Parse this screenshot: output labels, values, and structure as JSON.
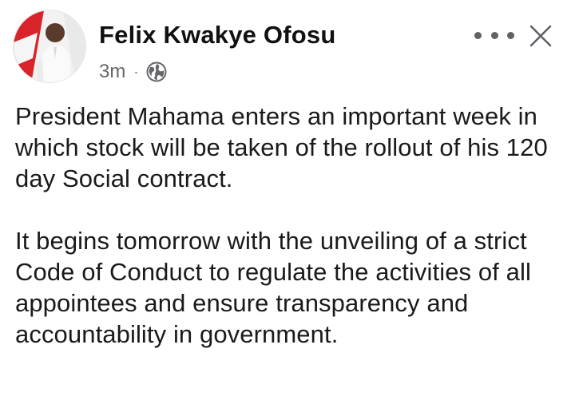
{
  "post": {
    "author": "Felix Kwakye Ofosu",
    "time": "3m",
    "separator": "·",
    "privacy_icon": "globe-icon",
    "more_icon": "more-horizontal-icon",
    "close_icon": "close-icon",
    "paragraphs": [
      "President Mahama enters an important week in which stock will be taken of the rollout of his 120 day Social contract.",
      "It begins tomorrow with the unveiling of a strict Code of Conduct to regulate the activities of all appointees and ensure transparency and accountability in government."
    ]
  },
  "colors": {
    "text": "#1a1a1a",
    "meta": "#65676b",
    "avatar_ring": "#d8232a"
  }
}
